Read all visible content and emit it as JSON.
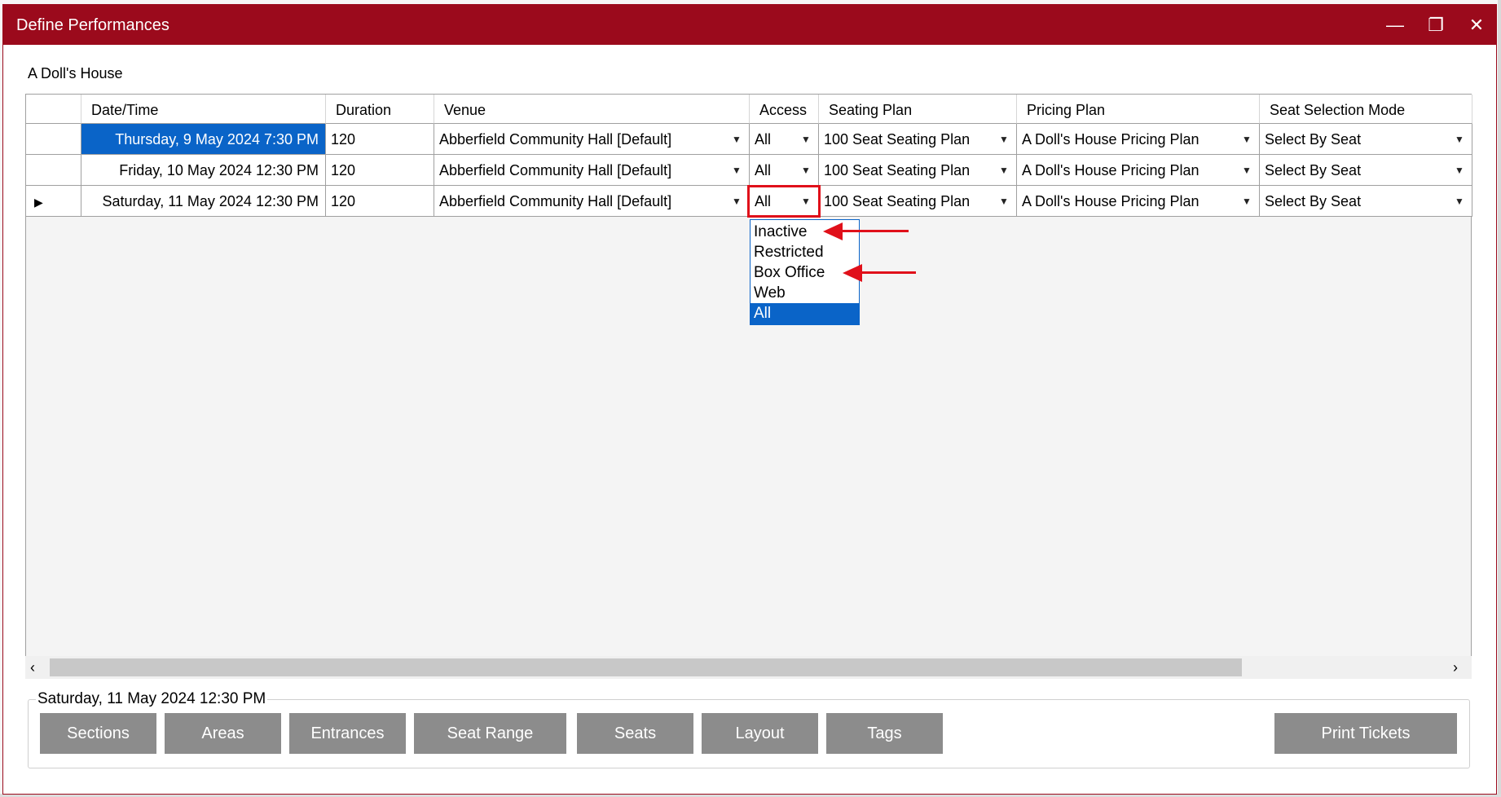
{
  "window": {
    "title": "Define Performances",
    "controls": {
      "minimize": "—",
      "maximize": "❐",
      "close": "✕"
    }
  },
  "production_title": "A Doll's House",
  "grid": {
    "columns": [
      "Date/Time",
      "Duration",
      "Venue",
      "Access",
      "Seating Plan",
      "Pricing Plan",
      "Seat Selection Mode"
    ],
    "rows": [
      {
        "datetime": "Thursday, 9 May 2024 7:30 PM",
        "duration": "120",
        "venue": "Abberfield Community Hall [Default]",
        "access": "All",
        "seating_plan": "100 Seat Seating Plan",
        "pricing_plan": "A Doll's House Pricing Plan",
        "seat_mode": "Select By Seat"
      },
      {
        "datetime": "Friday, 10 May 2024 12:30 PM",
        "duration": "120",
        "venue": "Abberfield Community Hall [Default]",
        "access": "All",
        "seating_plan": "100 Seat Seating Plan",
        "pricing_plan": "A Doll's House Pricing Plan",
        "seat_mode": "Select By Seat"
      },
      {
        "datetime": "Saturday, 11 May 2024 12:30 PM",
        "duration": "120",
        "venue": "Abberfield Community Hall [Default]",
        "access": "All",
        "seating_plan": "100 Seat Seating Plan",
        "pricing_plan": "A Doll's House Pricing Plan",
        "seat_mode": "Select By Seat"
      }
    ],
    "combo_arrow": "▼",
    "row_pointer": "▶"
  },
  "access_dropdown": {
    "options": [
      "Inactive",
      "Restricted",
      "Box Office",
      "Web",
      "All"
    ],
    "selected": "All"
  },
  "scrollbar": {
    "left": "‹",
    "right": "›"
  },
  "performance_group": {
    "label": "Saturday, 11 May 2024 12:30 PM",
    "buttons": {
      "sections": "Sections",
      "areas": "Areas",
      "entrances": "Entrances",
      "seat_range": "Seat Range",
      "seats": "Seats",
      "layout": "Layout",
      "tags": "Tags",
      "print_tickets": "Print Tickets"
    }
  },
  "colors": {
    "titlebar": "#9b0a1c",
    "selection": "#0a64c8",
    "annotation": "#e0101a",
    "button": "#8c8c8c"
  }
}
